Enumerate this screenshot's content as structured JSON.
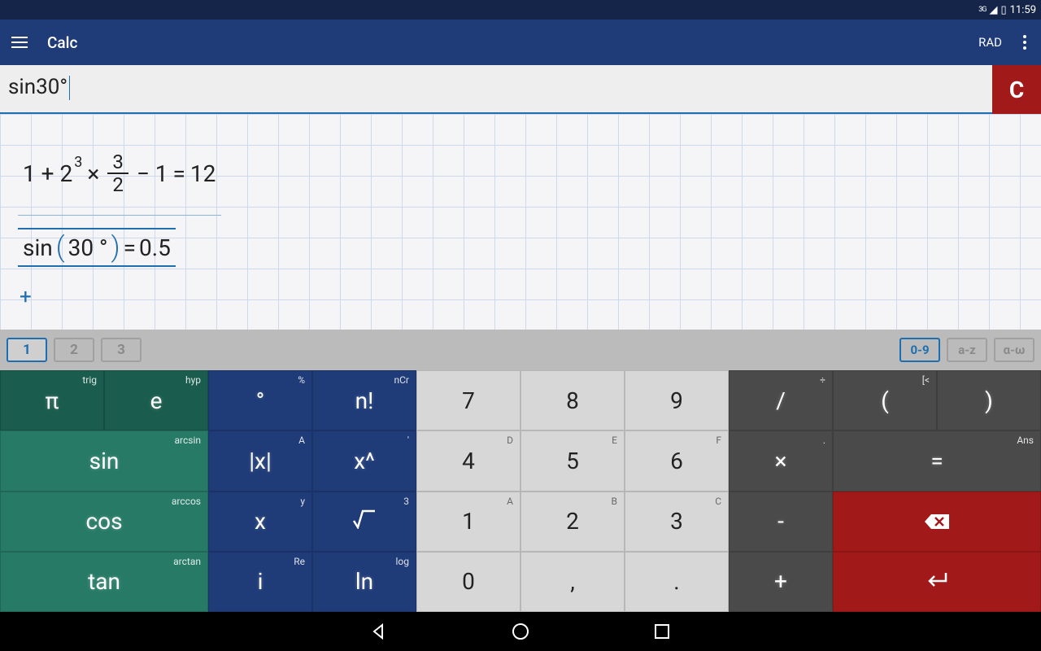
{
  "statusbar": {
    "network": "3G",
    "time": "11:59"
  },
  "toolbar": {
    "title": "Calc",
    "angle_mode": "RAD"
  },
  "input": {
    "value": "sin30°",
    "clear_label": "C"
  },
  "worksheet": {
    "expr1": {
      "lhs_a": "1 + 2",
      "exp": "3",
      "times": "×",
      "frac_num": "3",
      "frac_den": "2",
      "minus": "− 1",
      "eq": "=",
      "result": "12"
    },
    "expr2": {
      "fn": "sin",
      "arg": "30 °",
      "eq": "=",
      "result": "0.5"
    },
    "add": "+"
  },
  "tabs": {
    "pages": [
      "1",
      "2",
      "3"
    ],
    "active_page": 0,
    "modes": [
      "0-9",
      "a-z",
      "α-ω"
    ],
    "active_mode": 0
  },
  "keys": {
    "r1": [
      {
        "main": "π",
        "alt": "trig",
        "cls": "k-green-d"
      },
      {
        "main": "e",
        "alt": "hyp",
        "cls": "k-green-d"
      },
      {
        "main": "°",
        "alt": "%",
        "cls": "k-blue"
      },
      {
        "main": "n!",
        "alt": "nCr",
        "cls": "k-blue"
      },
      {
        "main": "7",
        "alt": "",
        "cls": "k-light"
      },
      {
        "main": "8",
        "alt": "",
        "cls": "k-light"
      },
      {
        "main": "9",
        "alt": "",
        "cls": "k-light"
      },
      {
        "main": "/",
        "alt": "÷",
        "cls": "k-gray"
      },
      {
        "main": "(",
        "alt": "[<",
        "cls": "k-gray"
      },
      {
        "main": ")",
        "alt": "",
        "cls": "k-gray"
      }
    ],
    "r2": [
      {
        "main": "sin",
        "alt": "arcsin",
        "cls": "k-green"
      },
      {
        "main": "|x|",
        "alt": "A",
        "cls": "k-blue"
      },
      {
        "main": "x^",
        "alt": "'",
        "cls": "k-blue"
      },
      {
        "main": "4",
        "alt": "D",
        "cls": "k-light"
      },
      {
        "main": "5",
        "alt": "E",
        "cls": "k-light"
      },
      {
        "main": "6",
        "alt": "F",
        "cls": "k-light"
      },
      {
        "main": "×",
        "alt": ".",
        "cls": "k-gray"
      },
      {
        "main": "=",
        "alt": "Ans",
        "cls": "k-gray"
      }
    ],
    "r3": [
      {
        "main": "cos",
        "alt": "arccos",
        "cls": "k-green"
      },
      {
        "main": "x",
        "alt": "y",
        "cls": "k-blue"
      },
      {
        "main": "√",
        "alt": "3",
        "cls": "k-blue",
        "icon": "sqrt"
      },
      {
        "main": "1",
        "alt": "A",
        "cls": "k-light"
      },
      {
        "main": "2",
        "alt": "B",
        "cls": "k-light"
      },
      {
        "main": "3",
        "alt": "C",
        "cls": "k-light"
      },
      {
        "main": "-",
        "alt": "",
        "cls": "k-gray"
      },
      {
        "main": "⌫",
        "alt": "",
        "cls": "k-red",
        "icon": "bksp"
      }
    ],
    "r4": [
      {
        "main": "tan",
        "alt": "arctan",
        "cls": "k-green"
      },
      {
        "main": "i",
        "alt": "Re",
        "cls": "k-blue"
      },
      {
        "main": "ln",
        "alt": "log",
        "cls": "k-blue"
      },
      {
        "main": "0",
        "alt": "",
        "cls": "k-light"
      },
      {
        "main": ",",
        "alt": "",
        "cls": "k-light"
      },
      {
        "main": ".",
        "alt": "",
        "cls": "k-light"
      },
      {
        "main": "+",
        "alt": "",
        "cls": "k-gray"
      },
      {
        "main": "↵",
        "alt": "",
        "cls": "k-red",
        "icon": "enter"
      }
    ]
  }
}
